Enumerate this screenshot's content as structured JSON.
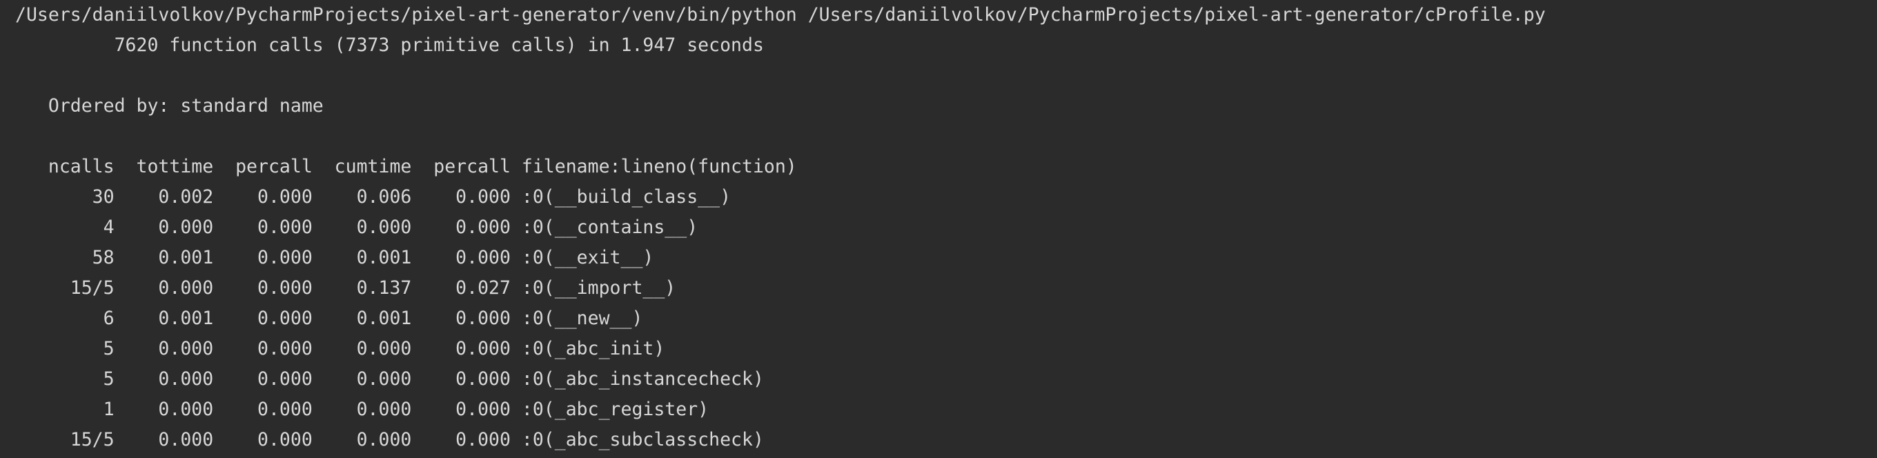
{
  "console": {
    "command_line": "/Users/daniilvolkov/PycharmProjects/pixel-art-generator/venv/bin/python /Users/daniilvolkov/PycharmProjects/pixel-art-generator/cProfile.py",
    "summary_line": "         7620 function calls (7373 primitive calls) in 1.947 seconds",
    "blank_1": "",
    "ordered_by": "   Ordered by: standard name",
    "blank_2": "",
    "header": "   ncalls  tottime  percall  cumtime  percall filename:lineno(function)",
    "rows": [
      "       30    0.002    0.000    0.006    0.000 :0(__build_class__)",
      "        4    0.000    0.000    0.000    0.000 :0(__contains__)",
      "       58    0.001    0.000    0.001    0.000 :0(__exit__)",
      "     15/5    0.000    0.000    0.137    0.027 :0(__import__)",
      "        6    0.001    0.000    0.001    0.000 :0(__new__)",
      "        5    0.000    0.000    0.000    0.000 :0(_abc_init)",
      "        5    0.000    0.000    0.000    0.000 :0(_abc_instancecheck)",
      "        1    0.000    0.000    0.000    0.000 :0(_abc_register)",
      "     15/5    0.000    0.000    0.000    0.000 :0(_abc_subclasscheck)"
    ]
  }
}
